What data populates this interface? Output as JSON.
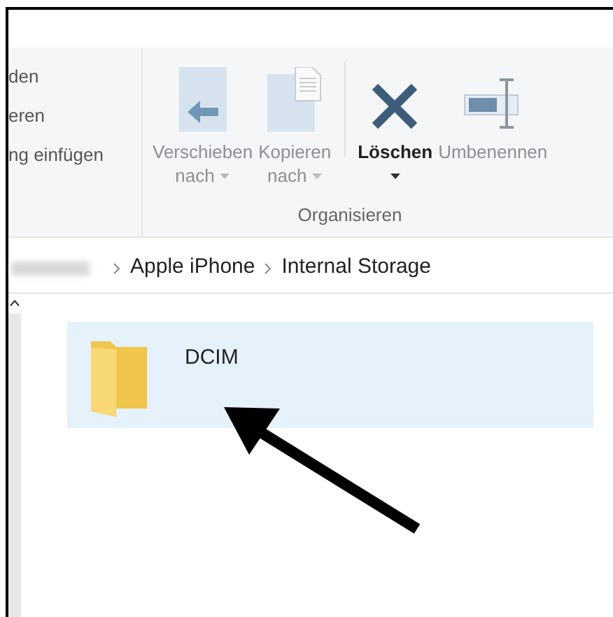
{
  "ribbon": {
    "left_items": [
      "den",
      "eren",
      "ng einfügen"
    ],
    "buttons": [
      {
        "kind": "move",
        "label": "Verschieben",
        "sublabel": "nach",
        "disabled": true
      },
      {
        "kind": "copy",
        "label": "Kopieren",
        "sublabel": "nach",
        "disabled": true
      },
      {
        "kind": "delete",
        "label": "Löschen",
        "disabled": false
      },
      {
        "kind": "rename",
        "label": "Umbenennen",
        "disabled": true
      }
    ],
    "group_label": "Organisieren"
  },
  "breadcrumb": [
    "Apple iPhone",
    "Internal Storage"
  ],
  "items": [
    {
      "name": "DCIM",
      "selected": true
    }
  ]
}
